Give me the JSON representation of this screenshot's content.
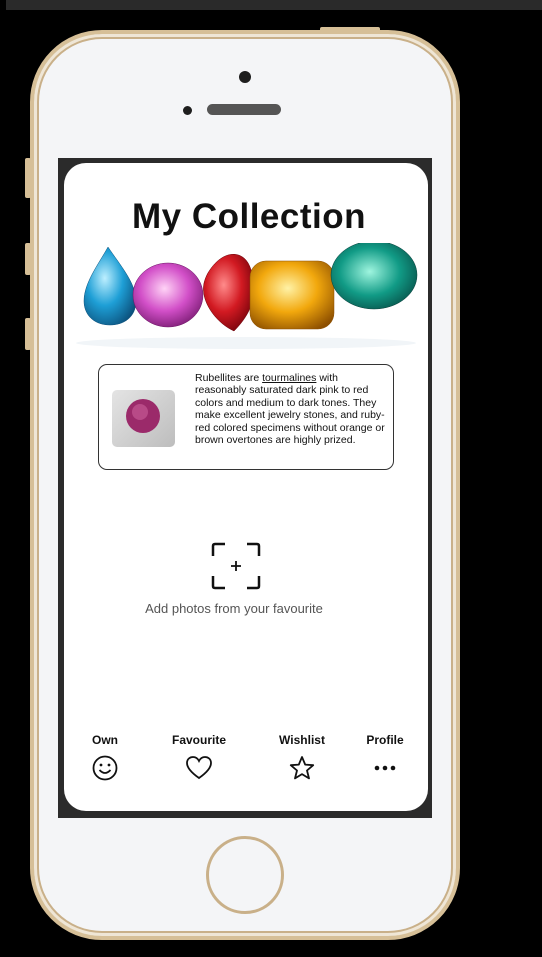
{
  "page": {
    "title": "My Collection"
  },
  "info_card": {
    "text_before": "Rubellites are ",
    "link": "tourmalines",
    "text_after": " with reasonably saturated dark pink to red colors and medium to dark tones. They make excellent jewelry stones, and ruby-red colored specimens without orange or brown overtones are highly prized."
  },
  "add_photo": {
    "text": "Add photos from your favourite"
  },
  "nav": {
    "items": [
      {
        "label": "Own",
        "icon": "smiley-icon"
      },
      {
        "label": "Favourite",
        "icon": "heart-icon"
      },
      {
        "label": "Wishlist",
        "icon": "star-icon"
      },
      {
        "label": "Profile",
        "icon": "more-dots-icon"
      }
    ]
  },
  "colors": {
    "phone_frame": "#d6bf97",
    "gem_blue": "#1e9fd6",
    "gem_pink": "#d24fc8",
    "gem_red": "#d21a22",
    "gem_yellow": "#f2a80d",
    "gem_teal": "#119b86"
  }
}
